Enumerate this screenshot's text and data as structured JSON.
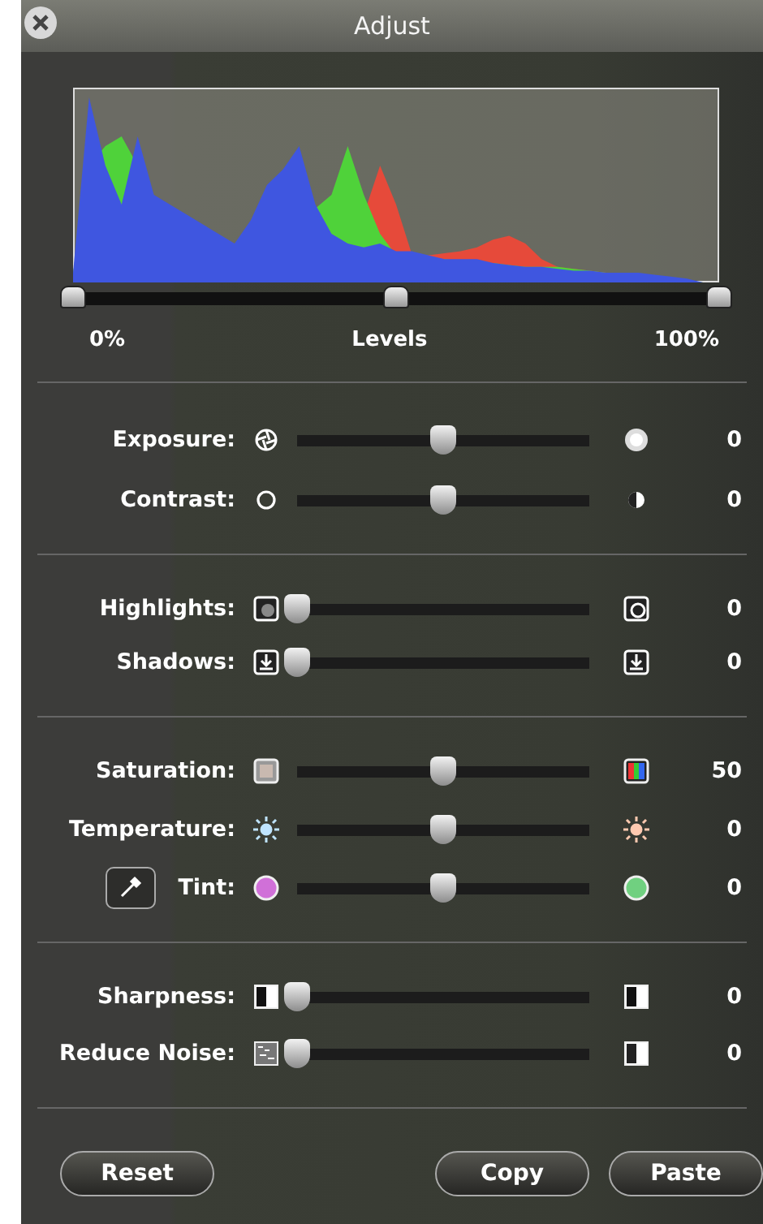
{
  "window": {
    "title": "Adjust"
  },
  "levels": {
    "thumbs": [
      {
        "level": 0
      },
      {
        "level": 0.5
      },
      {
        "level": 1
      }
    ],
    "min_label": "0%",
    "label": "Levels",
    "max_label": "100%"
  },
  "groups": [
    {
      "rows": [
        {
          "kind": "plain",
          "label": "Exposure:",
          "level": 0.5,
          "value": "0"
        },
        {
          "kind": "plain",
          "label": "Contrast:",
          "level": 0.5,
          "value": "0"
        }
      ]
    },
    {
      "rows": [
        {
          "kind": "plain",
          "label": "Highlights:",
          "level": 0,
          "value": "0"
        },
        {
          "kind": "plain",
          "label": "Shadows:",
          "level": 0,
          "value": "0"
        }
      ]
    },
    {
      "rows": [
        {
          "kind": "plain",
          "label": "Saturation:",
          "level": 0.5,
          "value": "50"
        },
        {
          "kind": "plain",
          "label": "Temperature:",
          "level": 0.5,
          "value": "0"
        },
        {
          "kind": "picker",
          "label": "Tint:",
          "level": 0.5,
          "value": "0"
        }
      ]
    },
    {
      "rows": [
        {
          "kind": "plain",
          "label": "Sharpness:",
          "level": 0,
          "value": "0"
        },
        {
          "kind": "plain",
          "label": "Reduce Noise:",
          "level": 0,
          "value": "0"
        }
      ]
    }
  ],
  "buttons": [
    "Reset",
    "Copy",
    "Paste"
  ]
}
